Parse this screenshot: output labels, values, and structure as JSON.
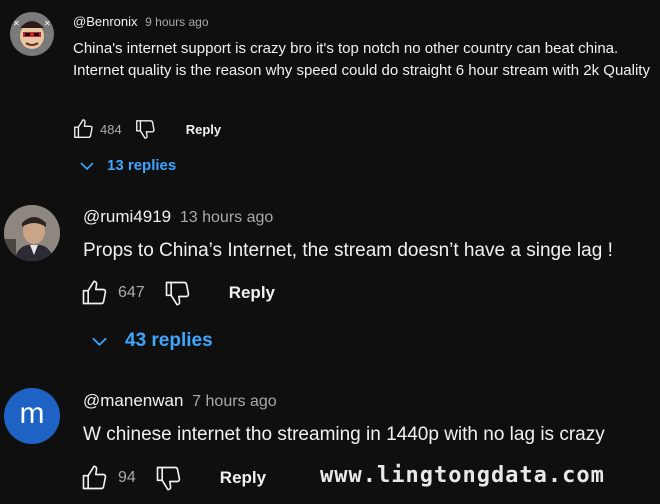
{
  "comments": [
    {
      "handle": "@Benronix",
      "time": "9 hours ago",
      "text": "China's internet support is crazy bro it's top notch no other country can beat china. Internet quality is the reason why speed could do straight 6 hour stream with 2k Quality",
      "likes": "484",
      "reply_label": "Reply",
      "replies_label": "13 replies"
    },
    {
      "handle": "@rumi4919",
      "time": "13 hours ago",
      "text": "Props to China’s Internet, the stream doesn’t have a singe lag !",
      "likes": "647",
      "reply_label": "Reply",
      "replies_label": "43 replies"
    },
    {
      "handle": "@manenwan",
      "time": "7 hours ago",
      "text": "W chinese internet tho streaming in 1440p with no lag is crazy",
      "avatar_letter": "m",
      "likes": "94",
      "reply_label": "Reply"
    }
  ],
  "watermark": "www.lingtongdata.com",
  "colors": {
    "link": "#3ea6ff",
    "avatar_m": "#1e63c4"
  },
  "icons": [
    "thumb-up-icon",
    "thumb-down-icon",
    "chevron-down-icon"
  ]
}
